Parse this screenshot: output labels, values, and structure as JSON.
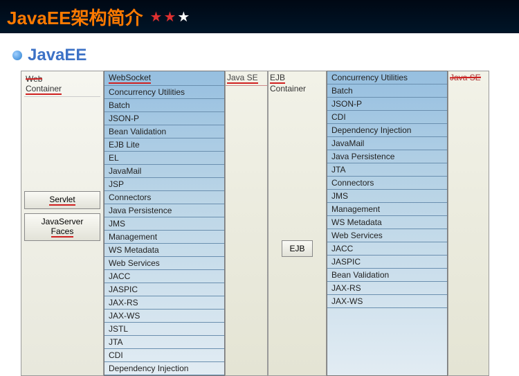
{
  "header": {
    "title": "JavaEE架构简介"
  },
  "subtitle": "JavaEE",
  "webContainer": {
    "line1": "Web",
    "line2": "Container",
    "servlet": "Servlet",
    "jsf1": "JavaServer",
    "jsf2": "Faces"
  },
  "apis1": [
    "WebSocket",
    "Concurrency Utilities",
    "Batch",
    "JSON-P",
    "Bean Validation",
    "EJB Lite",
    "EL",
    "JavaMail",
    "JSP",
    "Connectors",
    "Java Persistence",
    "JMS",
    "Management",
    "WS Metadata",
    "Web Services",
    "JACC",
    "JASPIC",
    "JAX-RS",
    "JAX-WS",
    "JSTL",
    "JTA",
    "CDI",
    "Dependency Injection"
  ],
  "javase": "Java SE",
  "ejbContainer": {
    "line1": "EJB",
    "line2": "Container",
    "ejb": "EJB"
  },
  "apis2": [
    "Concurrency Utilities",
    "Batch",
    "JSON-P",
    "CDI",
    "Dependency Injection",
    "JavaMail",
    "Java Persistence",
    "JTA",
    "Connectors",
    "JMS",
    "Management",
    "WS Metadata",
    "Web Services",
    "JACC",
    "JASPIC",
    "Bean Validation",
    "JAX-RS",
    "JAX-WS"
  ],
  "javaseRight": "Java SE"
}
